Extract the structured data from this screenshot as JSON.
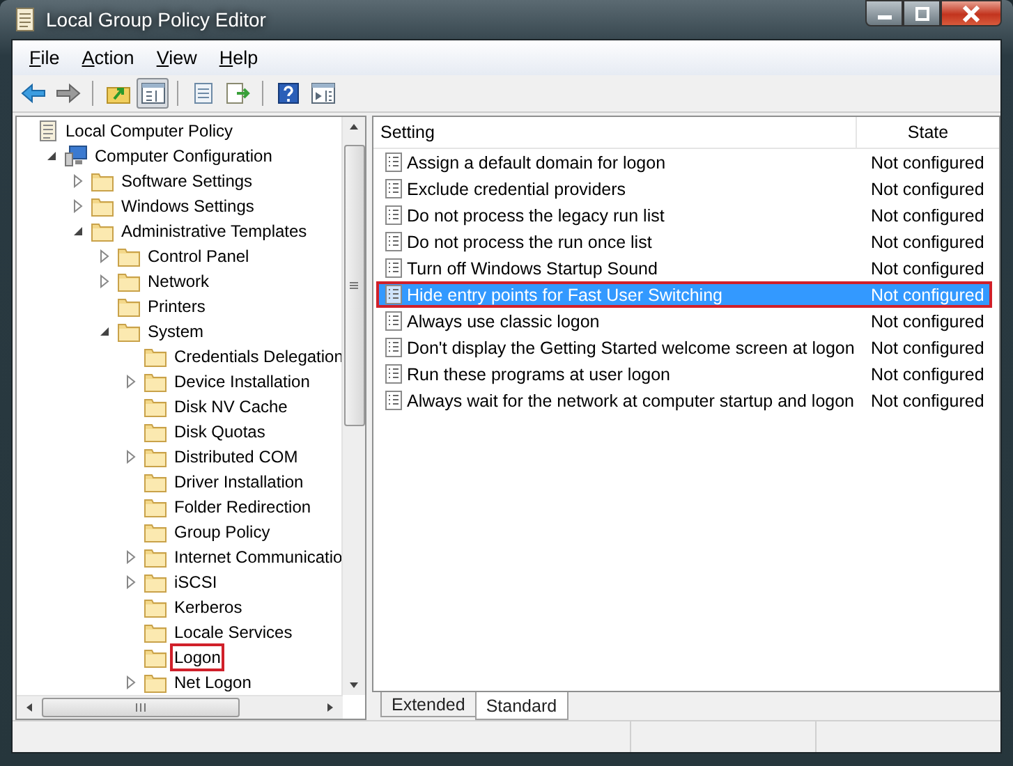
{
  "window": {
    "title": "Local Group Policy Editor"
  },
  "menu": [
    "File",
    "Action",
    "View",
    "Help"
  ],
  "toolbar": [
    {
      "kind": "back",
      "pressed": false
    },
    {
      "kind": "forward",
      "pressed": false
    },
    {
      "kind": "sep"
    },
    {
      "kind": "up",
      "pressed": false
    },
    {
      "kind": "tree",
      "pressed": true
    },
    {
      "kind": "sep"
    },
    {
      "kind": "properties",
      "pressed": false
    },
    {
      "kind": "export",
      "pressed": false
    },
    {
      "kind": "sep"
    },
    {
      "kind": "help",
      "pressed": false
    },
    {
      "kind": "actionpane",
      "pressed": false
    }
  ],
  "tree": [
    {
      "label": "Local Computer Policy",
      "kind": "policy",
      "children": [
        {
          "label": "Computer Configuration",
          "kind": "computer",
          "expanded": true,
          "children": [
            {
              "label": "Software Settings",
              "kind": "folder",
              "expanded": false
            },
            {
              "label": "Windows Settings",
              "kind": "folder",
              "expanded": false
            },
            {
              "label": "Administrative Templates",
              "kind": "folder",
              "expanded": true,
              "children": [
                {
                  "label": "Control Panel",
                  "kind": "folder",
                  "expanded": false
                },
                {
                  "label": "Network",
                  "kind": "folder",
                  "expanded": false
                },
                {
                  "label": "Printers",
                  "kind": "folder"
                },
                {
                  "label": "System",
                  "kind": "folder",
                  "expanded": true,
                  "children": [
                    {
                      "label": "Credentials Delegation",
                      "kind": "folder"
                    },
                    {
                      "label": "Device Installation",
                      "kind": "folder",
                      "expanded": false
                    },
                    {
                      "label": "Disk NV Cache",
                      "kind": "folder"
                    },
                    {
                      "label": "Disk Quotas",
                      "kind": "folder"
                    },
                    {
                      "label": "Distributed COM",
                      "kind": "folder",
                      "expanded": false
                    },
                    {
                      "label": "Driver Installation",
                      "kind": "folder"
                    },
                    {
                      "label": "Folder Redirection",
                      "kind": "folder"
                    },
                    {
                      "label": "Group Policy",
                      "kind": "folder"
                    },
                    {
                      "label": "Internet Communicatio",
                      "kind": "folder",
                      "expanded": false
                    },
                    {
                      "label": "iSCSI",
                      "kind": "folder",
                      "expanded": false
                    },
                    {
                      "label": "Kerberos",
                      "kind": "folder"
                    },
                    {
                      "label": "Locale Services",
                      "kind": "folder"
                    },
                    {
                      "label": "Logon",
                      "kind": "folder",
                      "highlighted": true
                    },
                    {
                      "label": "Net Logon",
                      "kind": "folder",
                      "expanded": false
                    }
                  ]
                }
              ]
            }
          ]
        }
      ]
    }
  ],
  "table": {
    "columns": [
      "Setting",
      "State"
    ],
    "rows": [
      {
        "setting": "Assign a default domain for logon",
        "state": "Not configured",
        "selected": false,
        "highlighted": false
      },
      {
        "setting": "Exclude credential providers",
        "state": "Not configured",
        "selected": false,
        "highlighted": false
      },
      {
        "setting": "Do not process the legacy run list",
        "state": "Not configured",
        "selected": false,
        "highlighted": false
      },
      {
        "setting": "Do not process the run once list",
        "state": "Not configured",
        "selected": false,
        "highlighted": false
      },
      {
        "setting": "Turn off Windows Startup Sound",
        "state": "Not configured",
        "selected": false,
        "highlighted": false
      },
      {
        "setting": "Hide entry points for Fast User Switching",
        "state": "Not configured",
        "selected": true,
        "highlighted": true
      },
      {
        "setting": "Always use classic logon",
        "state": "Not configured",
        "selected": false,
        "highlighted": false
      },
      {
        "setting": "Don't display the Getting Started welcome screen at logon",
        "state": "Not configured",
        "selected": false,
        "highlighted": false
      },
      {
        "setting": "Run these programs at user logon",
        "state": "Not configured",
        "selected": false,
        "highlighted": false
      },
      {
        "setting": "Always wait for the network at computer startup and logon",
        "state": "Not configured",
        "selected": false,
        "highlighted": false
      }
    ]
  },
  "view_tabs": [
    {
      "label": "Extended",
      "selected": false
    },
    {
      "label": "Standard",
      "selected": true
    }
  ]
}
